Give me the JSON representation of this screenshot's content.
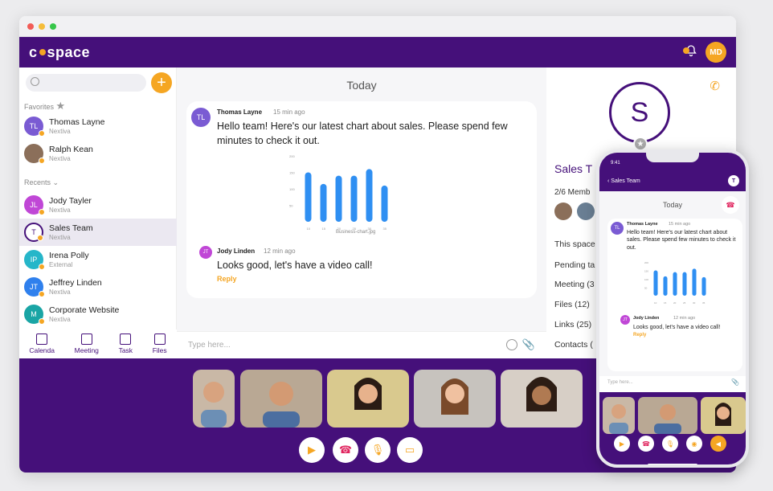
{
  "app": {
    "brand": "c•space",
    "user_initials": "MD"
  },
  "sidebar": {
    "favorites_label": "Favorites",
    "recents_label": "Recents",
    "favorites": [
      {
        "initials": "TL",
        "name": "Thomas Layne",
        "sub": "Nextiva",
        "color": "#7a5bd3",
        "photo": false
      },
      {
        "initials": "",
        "name": "Ralph Kean",
        "sub": "Nextiva",
        "color": "#8b6f5a",
        "photo": true
      }
    ],
    "recents": [
      {
        "initials": "JL",
        "name": "Jody Tayler",
        "sub": "Nextiva",
        "color": "#c047d6",
        "active": false
      },
      {
        "initials": "T",
        "name": "Sales Team",
        "sub": "Nextiva",
        "color": "#45107a",
        "active": true
      },
      {
        "initials": "IP",
        "name": "Irena Polly",
        "sub": "External",
        "color": "#26b6c9",
        "active": false
      },
      {
        "initials": "JT",
        "name": "Jeffrey Linden",
        "sub": "Nextiva",
        "color": "#2f80ed",
        "active": false
      },
      {
        "initials": "M",
        "name": "Corporate Website",
        "sub": "Nextiva",
        "color": "#1aa5a5",
        "active": false
      }
    ],
    "nav": [
      "Calenda",
      "Meeting",
      "Task",
      "Files"
    ]
  },
  "chat": {
    "day_label": "Today",
    "messages": [
      {
        "initials": "TL",
        "name": "Thomas Layne",
        "time": "15 min ago",
        "text": "Hello team! Here's our latest chart about sales. Please spend few minutes to check it out."
      },
      {
        "initials": "JT",
        "name": "Jody Linden",
        "time": "12 min ago",
        "text": "Looks good, let's have a video call!",
        "reply": "Reply"
      }
    ],
    "attachment_caption": "Business-chart.jpg",
    "composer_placeholder": "Type here..."
  },
  "chart_data": {
    "type": "bar",
    "categories": [
      "10",
      "15",
      "20",
      "25",
      "30",
      "35"
    ],
    "values": [
      150,
      115,
      140,
      140,
      160,
      110
    ],
    "ylabels": [
      "50",
      "100",
      "150",
      "200"
    ],
    "ylim": [
      0,
      200
    ],
    "color": "#2f8ff2"
  },
  "details": {
    "avatar_letter": "S",
    "title": "Sales T",
    "members": "2/6 Memb",
    "rows": [
      "This space",
      "Pending ta",
      "Meeting (3",
      "Files (12)",
      "Links (25)",
      "Contacts ("
    ]
  },
  "phone": {
    "status_time": "9:41",
    "title": "Sales Team",
    "t_badge": "T",
    "day_label": "Today",
    "messages": [
      {
        "initials": "TL",
        "name": "Thomas Layne",
        "time": "15 min ago",
        "text": "Hello team! Here's our latest chart about sales. Please spend few minutes to check it out."
      },
      {
        "initials": "JT",
        "name": "Jody Linden",
        "time": "12 min ago",
        "text": "Looks good, let's have a video call!",
        "reply": "Reply"
      }
    ],
    "composer_placeholder": "Type here..."
  },
  "colors": {
    "brand_purple": "#45107a",
    "accent_orange": "#f5a623",
    "hangup_red": "#e0245e"
  }
}
